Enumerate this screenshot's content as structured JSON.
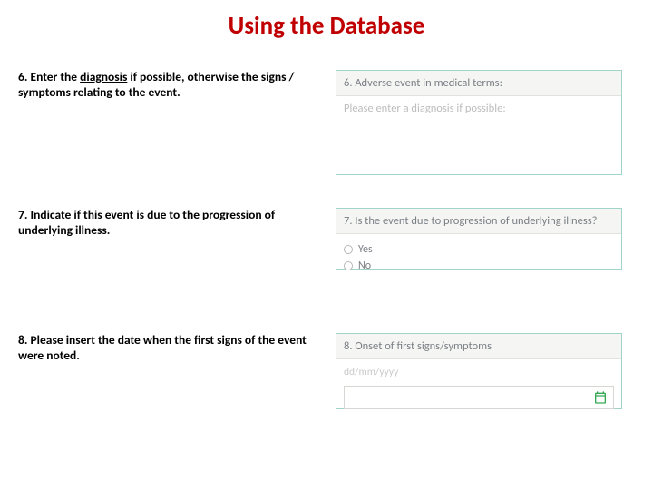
{
  "title": "Using the Database",
  "items": [
    {
      "instr_prefix": "6. Enter the ",
      "instr_underlined": "diagnosis",
      "instr_suffix": " if possible, otherwise the signs / symptoms relating to the event.",
      "panel_header": "6. Adverse event in medical terms:",
      "placeholder": "Please enter a diagnosis if possible:"
    },
    {
      "instr": "7. Indicate if this event is due to the progression of underlying illness.",
      "panel_header": "7. Is the event due to progression of underlying illness?",
      "options": [
        "Yes",
        "No"
      ]
    },
    {
      "instr": "8.  Please insert the date when the first signs of the event were noted.",
      "panel_header": "8. Onset of first signs/symptoms",
      "date_format": "dd/mm/yyyy"
    }
  ]
}
